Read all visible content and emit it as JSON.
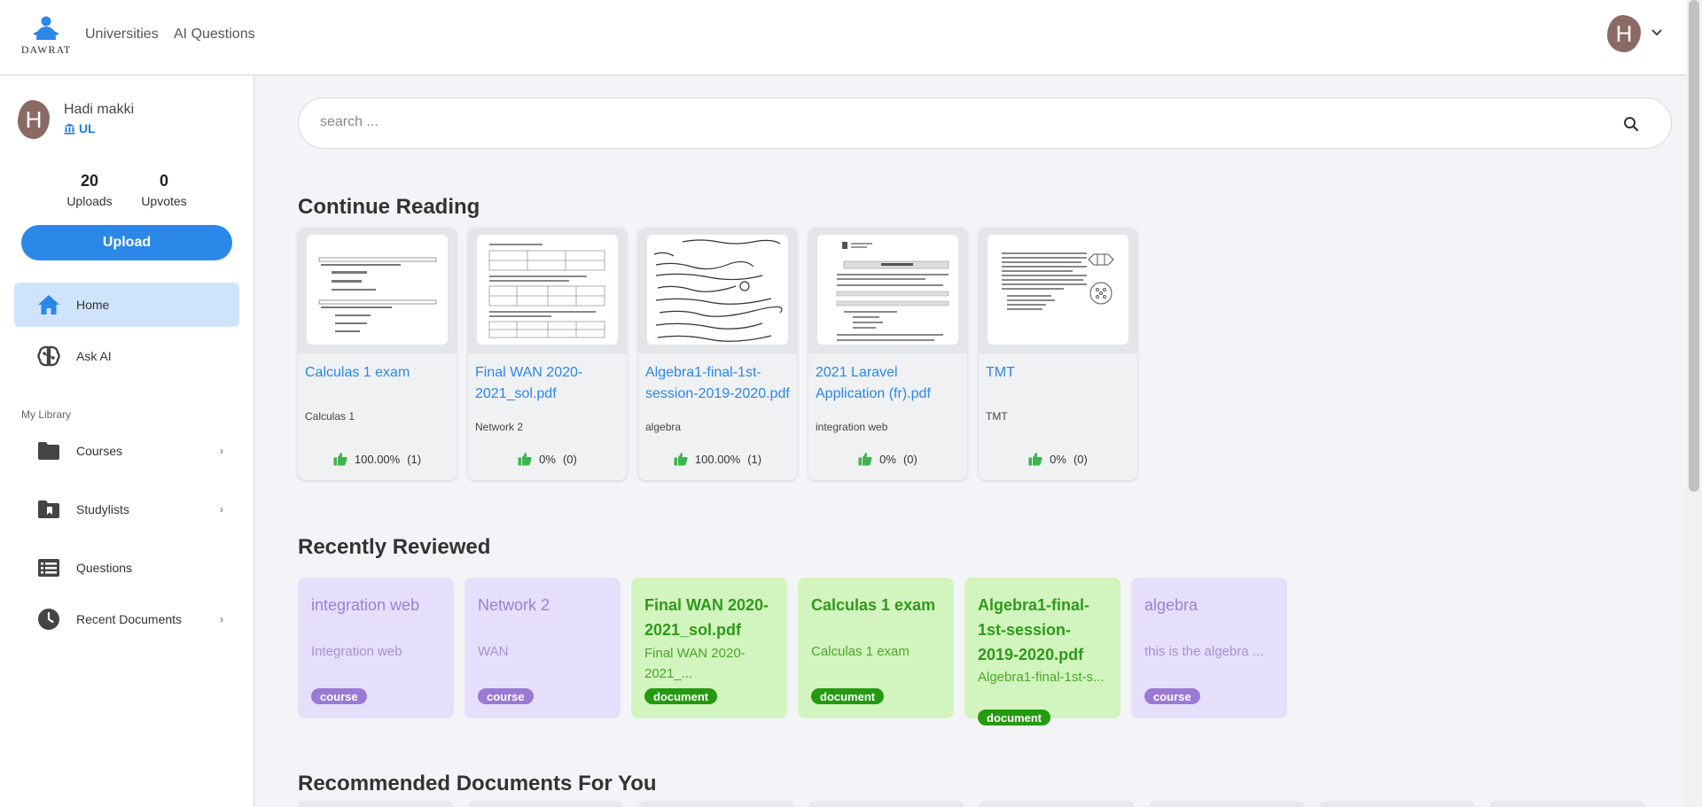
{
  "header": {
    "logo_text": "DAWRAT",
    "nav": [
      "Universities",
      "AI Questions"
    ],
    "avatar_letter": "H"
  },
  "sidebar": {
    "user": {
      "avatar_letter": "H",
      "name": "Hadi makki",
      "university": "UL"
    },
    "stats": {
      "uploads_value": "20",
      "uploads_label": "Uploads",
      "upvotes_value": "0",
      "upvotes_label": "Upvotes"
    },
    "upload_label": "Upload",
    "items": [
      {
        "label": "Home",
        "icon": "home-icon"
      },
      {
        "label": "Ask AI",
        "icon": "brain-icon"
      }
    ],
    "library_heading": "My Library",
    "library_items": [
      {
        "label": "Courses",
        "icon": "folder-icon",
        "arrow": "›"
      },
      {
        "label": "Studylists",
        "icon": "bookmark-folder-icon",
        "arrow": "›"
      },
      {
        "label": "Questions",
        "icon": "list-icon"
      },
      {
        "label": "Recent Documents",
        "icon": "clock-icon",
        "arrow": "›"
      }
    ]
  },
  "search": {
    "placeholder": "search ..."
  },
  "sections": {
    "continue_reading": "Continue Reading",
    "recently_reviewed": "Recently Reviewed",
    "recommended": "Recommended Documents For You"
  },
  "continue_reading": [
    {
      "title": "Calculas 1 exam",
      "course": "Calculas 1",
      "rating": "100.00%",
      "count": "(1)"
    },
    {
      "title": "Final WAN 2020-2021_sol.pdf",
      "course": "Network 2",
      "rating": "0%",
      "count": "(0)"
    },
    {
      "title": "Algebra1-final-1st-session-2019-2020.pdf",
      "course": "algebra",
      "rating": "100.00%",
      "count": "(1)"
    },
    {
      "title": "2021 Laravel Application (fr).pdf",
      "course": "integration web",
      "rating": "0%",
      "count": "(0)"
    },
    {
      "title": "TMT",
      "course": "TMT",
      "rating": "0%",
      "count": "(0)"
    }
  ],
  "recently_reviewed": [
    {
      "title": "integration web",
      "subtitle": "Integration web",
      "badge": "course",
      "kind": "course"
    },
    {
      "title": "Network 2",
      "subtitle": "WAN",
      "badge": "course",
      "kind": "course"
    },
    {
      "title": "Final WAN 2020-2021_sol.pdf",
      "subtitle": "Final WAN 2020-2021_...",
      "badge": "document",
      "kind": "document"
    },
    {
      "title": "Calculas 1 exam",
      "subtitle": "Calculas 1 exam",
      "badge": "document",
      "kind": "document"
    },
    {
      "title": "Algebra1-final-1st-session-2019-2020.pdf",
      "subtitle": "Algebra1-final-1st-s...",
      "badge": "document",
      "kind": "document"
    },
    {
      "title": "algebra",
      "subtitle": "this is the algebra ...",
      "badge": "course",
      "kind": "course"
    }
  ],
  "colors": {
    "accent": "#2b87e8",
    "active_nav_bg": "#cfe4fa",
    "course_bg": "#e6dffc",
    "document_bg": "#d2f4be",
    "thumb_up": "#3cb44b"
  }
}
